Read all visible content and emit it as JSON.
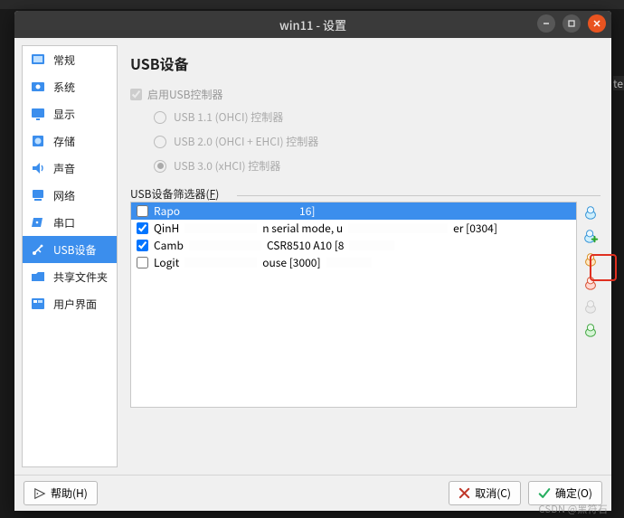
{
  "titlebar": {
    "title": "win11 - 设置"
  },
  "sidebar": {
    "items": [
      {
        "label": "常规",
        "icon": "general"
      },
      {
        "label": "系统",
        "icon": "system"
      },
      {
        "label": "显示",
        "icon": "display"
      },
      {
        "label": "存储",
        "icon": "storage"
      },
      {
        "label": "声音",
        "icon": "audio"
      },
      {
        "label": "网络",
        "icon": "network"
      },
      {
        "label": "串口",
        "icon": "serial"
      },
      {
        "label": "USB设备",
        "icon": "usb",
        "selected": true
      },
      {
        "label": "共享文件夹",
        "icon": "shared"
      },
      {
        "label": "用户界面",
        "icon": "ui"
      }
    ]
  },
  "page": {
    "title": "USB设备",
    "enable_label": "启用USB控制器",
    "enable_checked": true,
    "controllers": [
      {
        "label": "USB 1.1 (OHCI) 控制器",
        "selected": false
      },
      {
        "label": "USB 2.0 (OHCI + EHCI) 控制器",
        "selected": false
      },
      {
        "label": "USB 3.0 (xHCI) 控制器",
        "selected": true
      }
    ],
    "filter_label": "USB设备筛选器(F)",
    "filters": [
      {
        "checked": false,
        "selected": true,
        "prefix": "Rapo",
        "mid": "",
        "suffix": "16]"
      },
      {
        "checked": true,
        "selected": false,
        "prefix": "QinH",
        "mid": "n serial mode, u",
        "suffix": "er [0304]"
      },
      {
        "checked": true,
        "selected": false,
        "prefix": "Camb",
        "mid": "CSR8510 A10 [8",
        "suffix": ""
      },
      {
        "checked": false,
        "selected": false,
        "prefix": "Logit",
        "mid": "ouse [3000]",
        "suffix": ""
      }
    ]
  },
  "footer": {
    "help": "帮助(H)",
    "cancel": "取消(C)",
    "ok": "确定(O)"
  },
  "watermark": "CSDN @黑符石"
}
